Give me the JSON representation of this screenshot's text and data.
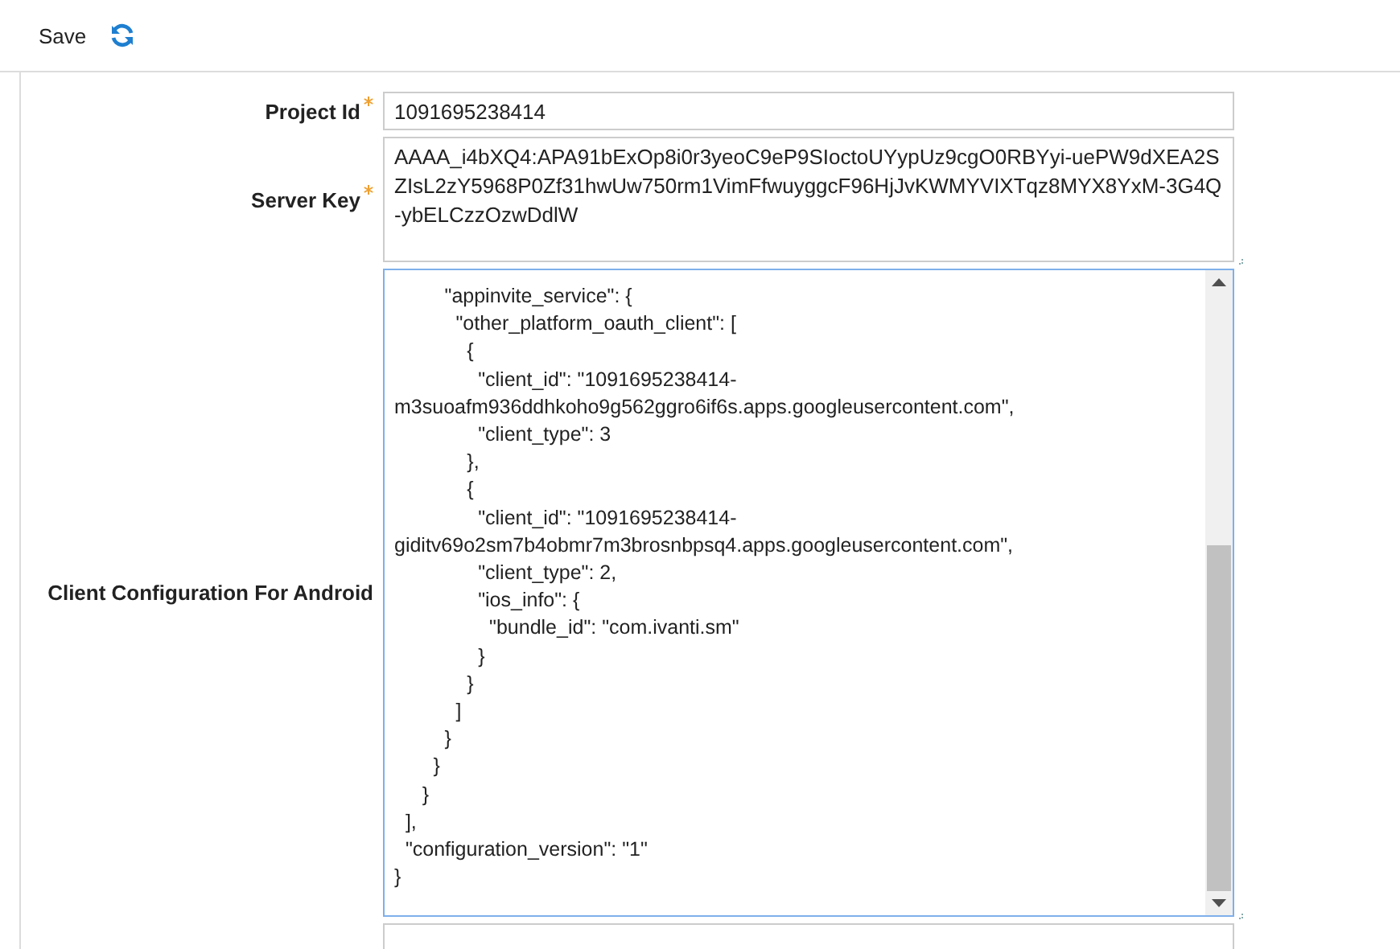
{
  "toolbar": {
    "save_label": "Save"
  },
  "fields": [
    {
      "kind": "input",
      "label": "Project Id",
      "required": true,
      "value": "1091695238414"
    },
    {
      "kind": "textarea",
      "label": "Server Key",
      "required": true,
      "value": "AAAA_i4bXQ4:APA91bExOp8i0r3yeoC9eP9SIoctoUYypUz9cgO0RBYyi-uePW9dXEA2SZIsL2zY5968P0Zf31hwUw750rm1VimFfwuyggcF96HjJvKWMYVIXTqz8MYX8YxM-3G4Q-ybELCzzOzwDdlW"
    },
    {
      "kind": "code",
      "label": "Client Configuration For Android",
      "required": false,
      "lines": [
        "         \"appinvite_service\": {",
        "           \"other_platform_oauth_client\": [",
        "             {",
        "               \"client_id\": \"1091695238414-",
        "m3suoafm936ddhkoho9g562ggro6if6s.apps.googleusercontent.com\",",
        "               \"client_type\": 3",
        "             },",
        "             {",
        "               \"client_id\": \"1091695238414-",
        "giditv69o2sm7b4obmr7m3brosnbpsq4.apps.googleusercontent.com\",",
        "               \"client_type\": 2,",
        "               \"ios_info\": {",
        "                 \"bundle_id\": \"com.ivanti.sm\"",
        "               }",
        "             }",
        "           ]",
        "         }",
        "       }",
        "     }",
        "  ],",
        "  \"configuration_version\": \"1\"",
        "}"
      ]
    },
    {
      "kind": "input",
      "required": false
    }
  ]
}
